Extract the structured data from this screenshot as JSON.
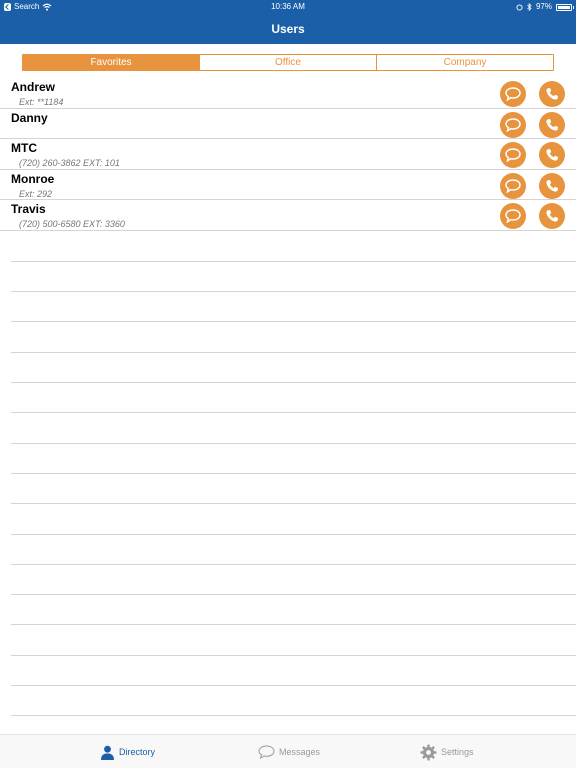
{
  "status_bar": {
    "back_label": "Search",
    "time": "10:36 AM",
    "battery_percent": "97%",
    "battery_level": 0.97
  },
  "nav": {
    "title": "Users"
  },
  "segments": [
    {
      "label": "Favorites",
      "active": true
    },
    {
      "label": "Office",
      "active": false
    },
    {
      "label": "Company",
      "active": false
    }
  ],
  "users": [
    {
      "name": "Andrew",
      "detail": "Ext: **1184"
    },
    {
      "name": "Danny",
      "detail": ""
    },
    {
      "name": "MTC",
      "detail": "(720) 260-3862 EXT: 101"
    },
    {
      "name": "Monroe",
      "detail": "Ext: 292"
    },
    {
      "name": "Travis",
      "detail": "(720) 500-6580 EXT: 3360"
    }
  ],
  "tabbar": {
    "directory": "Directory",
    "messages": "Messages",
    "settings": "Settings"
  },
  "colors": {
    "header": "#1a5fa8",
    "accent": "#e8933e",
    "tab_active": "#1a5fa8",
    "tab_inactive": "#9a9a9a"
  }
}
